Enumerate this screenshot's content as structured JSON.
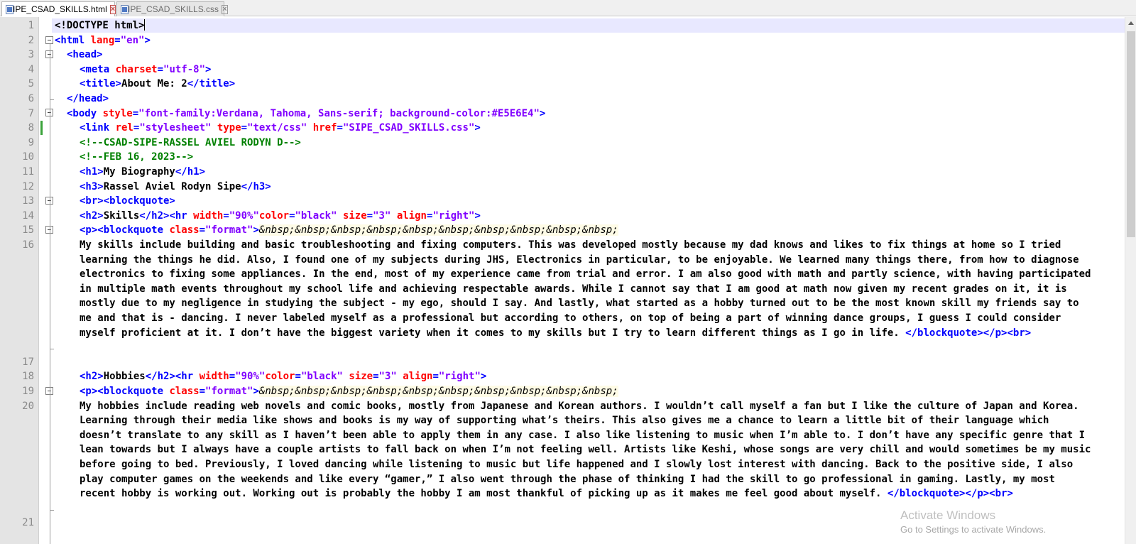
{
  "tabs": [
    {
      "name": "SIPE_CSAD_SKILLS.html",
      "active": true
    },
    {
      "name": "SIPE_CSAD_SKILLS.css",
      "active": false
    }
  ],
  "line_numbers": [
    "1",
    "2",
    "3",
    "4",
    "5",
    "6",
    "7",
    "8",
    "9",
    "10",
    "11",
    "12",
    "13",
    "14",
    "15",
    "16",
    "17",
    "18",
    "19",
    "20",
    "21"
  ],
  "code": {
    "l1": "<!DOCTYPE html>",
    "l2_open": "<html ",
    "l2_attr": "lang",
    "l2_eq": "=",
    "l2_val": "\"en\"",
    "l2_close": ">",
    "l3": "<head>",
    "l4_open": "<meta ",
    "l4_attr": "charset",
    "l4_val": "\"utf-8\"",
    "l5_open": "<title>",
    "l5_text": "About Me: 2",
    "l5_close": "</title>",
    "l6": "</head>",
    "l7_open": "<body ",
    "l7_attr": "style",
    "l7_val": "\"font-family:Verdana, Tahoma, Sans-serif; background-color:#E5E6E4\"",
    "l8_open": "<link ",
    "l8_attr1": "rel",
    "l8_val1": "\"stylesheet\"",
    "l8_attr2": "type",
    "l8_val2": "\"text/css\"",
    "l8_attr3": "href",
    "l8_val3": "\"SIPE_CSAD_SKILLS.css\"",
    "l9": "<!--CSAD-SIPE-RASSEL AVIEL RODYN D-->",
    "l10": "<!--FEB 16, 2023-->",
    "l11_open": "<h1>",
    "l11_text": "My Biography",
    "l11_close": "</h1>",
    "l12_open": "<h3>",
    "l12_text": "Rassel Aviel Rodyn Sipe",
    "l12_close": "</h3>",
    "l13": "<br><blockquote>",
    "l14_open": "<h2>",
    "l14_text": "Skills",
    "l14_close": "</h2><hr ",
    "hr_attr_width": "width",
    "hr_val_width": "\"90%\"",
    "hr_attr_color": "color",
    "hr_val_color": "\"black\"",
    "hr_attr_size": "size",
    "hr_val_size": "\"3\"",
    "hr_attr_align": "align",
    "hr_val_align": "\"right\"",
    "l15_open": "<p><blockquote ",
    "l15_attr": "class",
    "l15_val": "\"format\"",
    "nbsp": "&nbsp;&nbsp;&nbsp;&nbsp;&nbsp;&nbsp;&nbsp;&nbsp;&nbsp;&nbsp;",
    "l16_text": "My skills include building and basic troubleshooting and fixing computers. This was developed mostly because my dad knows and likes to fix things at home so I tried learning the things he did. Also, I found one of my subjects during JHS, Electronics in particular, to be enjoyable. We learned many things there, from how to diagnose electronics to fixing some appliances. In the end, most of my experience came from trial and error. I am also good with math and partly science, with having participated in multiple math events throughout my school life and achieving respectable awards. While I cannot say that I am good at math now given my recent grades on it, it is mostly due to my negligence in studying the subject - my ego, should I say. And lastly, what started as a hobby turned out to be the most known skill my friends say to me and that is - dancing. I never labeled myself as a professional but according to others, on top of being a part of winning dance groups, I guess I could consider myself proficient at it. I don’t have the biggest variety when it comes to my skills but I try to learn different things as I go in life. ",
    "para_close": "</blockquote></p><br>",
    "l18_text": "Hobbies",
    "l20_text": "My hobbies include reading web novels and comic books, mostly from Japanese and Korean authors. I wouldn’t call myself a fan but I like the culture of Japan and Korea. Learning through their media like shows and books is my way of supporting what’s theirs. This also gives me a chance to learn a little bit of their language which doesn’t translate to any skill as I haven’t been able to apply them in any case. I also like listening to music when I’m able to. I don’t have any specific genre that I lean towards but I always have a couple artists to fall back on when I’m not feeling well. Artists like Keshi, whose songs are very chill and would sometimes be my music before going to bed. Previously, I loved dancing while listening to music but life happened and I slowly lost interest with dancing. Back to the positive side, I also play computer games on the weekends and like every “gamer,” I also went through the phase of thinking I had the skill to go professional in gaming. Lastly, my most recent hobby is working out. Working out is probably the hobby I am most thankful of picking up as it makes me feel good about myself. "
  },
  "watermark": {
    "title": "Activate Windows",
    "subtitle": "Go to Settings to activate Windows."
  },
  "colors": {
    "tag": "#0000ff",
    "attribute": "#ff0000",
    "value": "#8000ff",
    "comment": "#008000",
    "gutter": "#e4e4e4",
    "current_line": "#e8e8ff"
  }
}
